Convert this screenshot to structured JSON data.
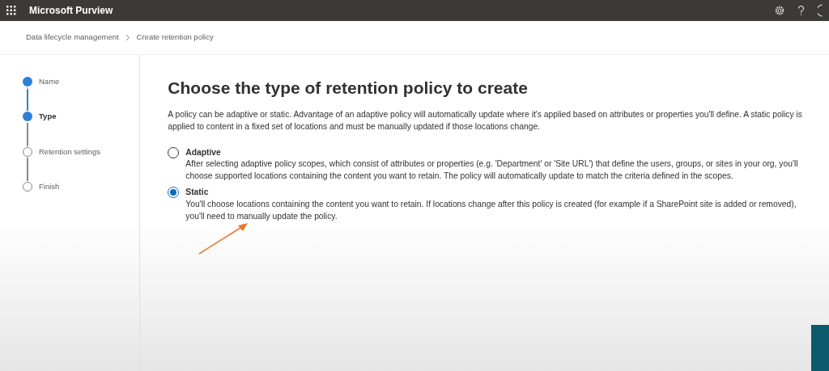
{
  "header": {
    "title": "Microsoft Purview"
  },
  "breadcrumb": [
    "Data lifecycle management",
    "Create retention policy"
  ],
  "steps": [
    {
      "label": "Name",
      "kind": "done"
    },
    {
      "label": "Type",
      "kind": "current"
    },
    {
      "label": "Retention settings",
      "kind": "todo"
    },
    {
      "label": "Finish",
      "kind": "todo"
    }
  ],
  "heading": "Choose the type of retention policy to create",
  "intro": "A policy can be adaptive or static. Advantage of an adaptive policy will automatically update where it's applied based on attributes or properties you'll define. A static policy is applied to content in a fixed set of locations and must be manually updated if those locations change.",
  "options": [
    {
      "label": "Adaptive",
      "description": "After selecting adaptive policy scopes, which consist of attributes or properties (e.g. 'Department' or 'Site URL') that define the users, groups, or sites in your org, you'll choose supported locations containing the content you want to retain. The policy will automatically update to match the criteria defined in the scopes.",
      "selected": false
    },
    {
      "label": "Static",
      "description": "You'll choose locations containing the content you want to retain. If locations change after this policy is created (for example if a SharePoint site is added or removed), you'll need to manually update the policy.",
      "selected": true
    }
  ]
}
